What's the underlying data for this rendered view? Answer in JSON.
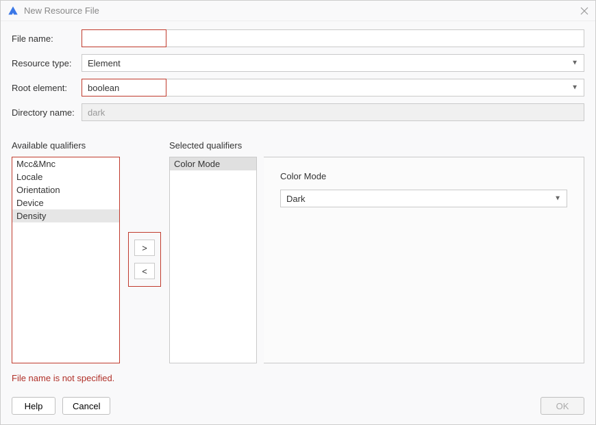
{
  "window": {
    "title": "New Resource File"
  },
  "form": {
    "file_name_label": "File name:",
    "file_name_value": "",
    "resource_type_label": "Resource type:",
    "resource_type_value": "Element",
    "root_element_label": "Root element:",
    "root_element_value": "boolean",
    "directory_name_label": "Directory name:",
    "directory_name_value": "dark"
  },
  "qualifiers": {
    "available_label": "Available qualifiers",
    "selected_label": "Selected qualifiers",
    "available": [
      "Mcc&Mnc",
      "Locale",
      "Orientation",
      "Device",
      "Density"
    ],
    "available_selected_index": 4,
    "selected": [
      "Color Mode"
    ],
    "selected_selected_index": 0,
    "move_right_label": ">",
    "move_left_label": "<"
  },
  "detail": {
    "label": "Color Mode",
    "value": "Dark"
  },
  "error": "File name is not specified.",
  "footer": {
    "help": "Help",
    "cancel": "Cancel",
    "ok": "OK"
  }
}
